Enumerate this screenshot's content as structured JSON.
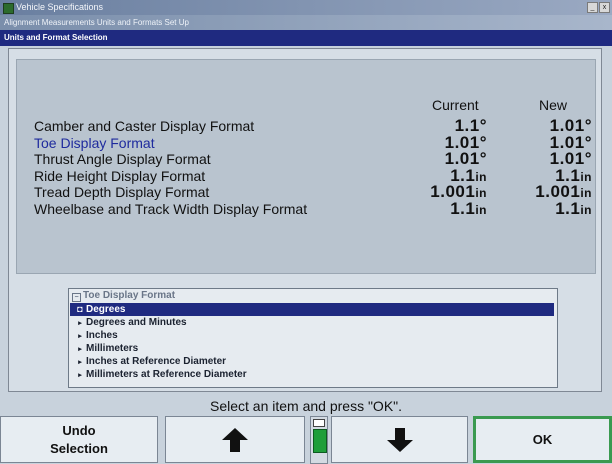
{
  "window": {
    "title": "Vehicle Specifications",
    "subtitle": "Alignment Measurements Units and Formats Set Up",
    "section": "Units and Format Selection",
    "controls": [
      "_",
      "□",
      "x"
    ]
  },
  "formats": {
    "col_current": "Current",
    "col_new": "New",
    "rows": [
      {
        "label": "Camber and Caster Display Format",
        "current": "1.1°",
        "new": "1.01°",
        "selected": false
      },
      {
        "label": "Toe Display Format",
        "current": "1.01°",
        "new": "1.01°",
        "selected": true
      },
      {
        "label": "Thrust Angle Display Format",
        "current": "1.01°",
        "new": "1.01°",
        "selected": false
      },
      {
        "label": "Ride Height Display Format",
        "current": "1.1in",
        "new": "1.1in",
        "selected": false
      },
      {
        "label": "Tread Depth Display Format",
        "current": "1.001in",
        "new": "1.001in",
        "selected": false
      },
      {
        "label": "Wheelbase and Track Width Display Format",
        "current": "1.1in",
        "new": "1.1in",
        "selected": false
      }
    ]
  },
  "options": {
    "title": "Toe Display Format",
    "title_marker": "−",
    "items": [
      {
        "label": "Degrees",
        "marker": "◘",
        "active": true
      },
      {
        "label": "Degrees and Minutes",
        "marker": "▸",
        "active": false
      },
      {
        "label": "Inches",
        "marker": "▸",
        "active": false
      },
      {
        "label": "Millimeters",
        "marker": "▸",
        "active": false
      },
      {
        "label": "Inches at Reference Diameter",
        "marker": "▸",
        "active": false
      },
      {
        "label": "Millimeters at Reference Diameter",
        "marker": "▸",
        "active": false
      }
    ]
  },
  "prompt": "Select an item and press \"OK\".",
  "buttons": {
    "undo": "Undo Selection",
    "up_icon": "up-arrow-icon",
    "down_icon": "down-arrow-icon",
    "ok": "OK"
  },
  "colors": {
    "accent": "#1f2a80",
    "selected_text": "#1f2b9e",
    "ok_border": "#3a9a50",
    "scroll_green": "#1f9e3a"
  }
}
